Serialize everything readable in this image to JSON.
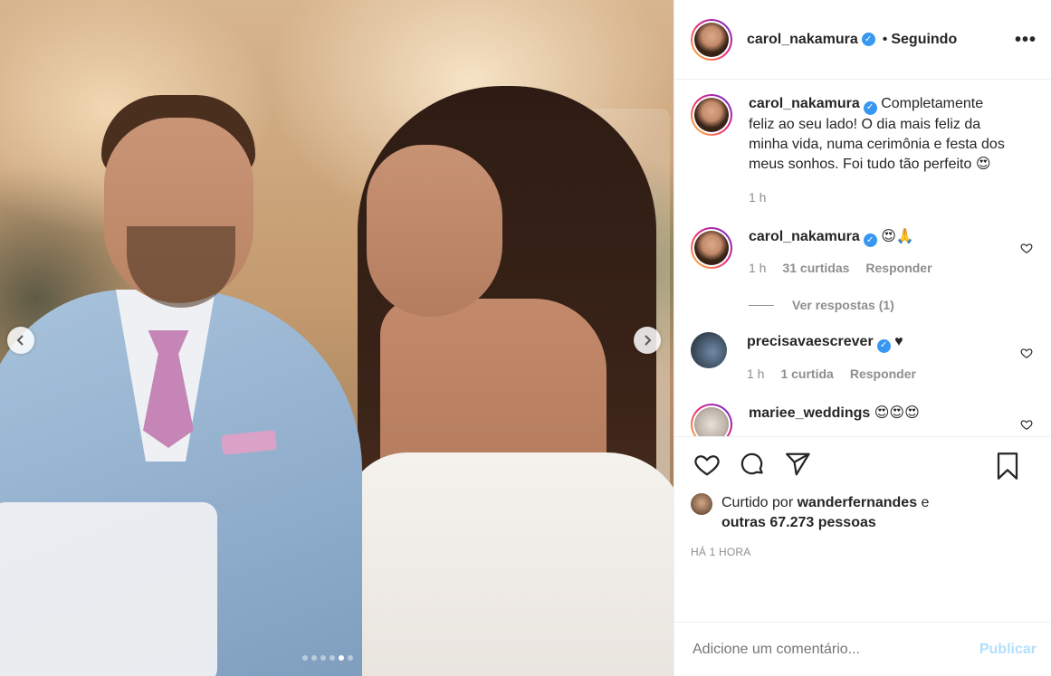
{
  "post": {
    "carousel": {
      "prev_icon": "chevron-left-icon",
      "next_icon": "chevron-right-icon",
      "dots_count": 6,
      "active_dot": 4
    }
  },
  "header": {
    "username": "carol_nakamura",
    "verified_icon": "verified-badge-icon",
    "separator": "•",
    "follow_status": "Seguindo",
    "more_icon": "more-options-icon",
    "more_glyph": "•••"
  },
  "caption": {
    "username": "carol_nakamura",
    "text": "Completamente feliz ao seu lado! O dia mais feliz da minha vida, numa cerimônia e festa dos meus sonhos. Foi tudo tão perfeito",
    "emoji": "😍",
    "time": "1 h"
  },
  "comments": [
    {
      "username": "carol_nakamura",
      "verified": true,
      "text": "😍🙏",
      "time": "1 h",
      "likes": "31 curtidas",
      "reply": "Responder",
      "view_replies": "Ver respostas (1)"
    },
    {
      "username": "precisavaescrever",
      "verified": true,
      "text": "♥",
      "time": "1 h",
      "likes": "1 curtida",
      "reply": "Responder"
    },
    {
      "username": "mariee_weddings",
      "verified": false,
      "text": "😍😍😍"
    }
  ],
  "actions": {
    "like_icon": "heart-icon",
    "comment_icon": "comment-icon",
    "share_icon": "share-icon",
    "save_icon": "bookmark-icon"
  },
  "likes": {
    "prefix": "Curtido por",
    "user": "wanderfernandes",
    "connector": "e",
    "others": "outras 67.273 pessoas"
  },
  "timestamp": "HÁ 1 HORA",
  "add_comment": {
    "placeholder": "Adicione um comentário...",
    "publish_label": "Publicar"
  },
  "colors": {
    "link_blue": "#b2dffc",
    "verified_blue": "#3897f0",
    "muted": "#8e8e8e"
  }
}
